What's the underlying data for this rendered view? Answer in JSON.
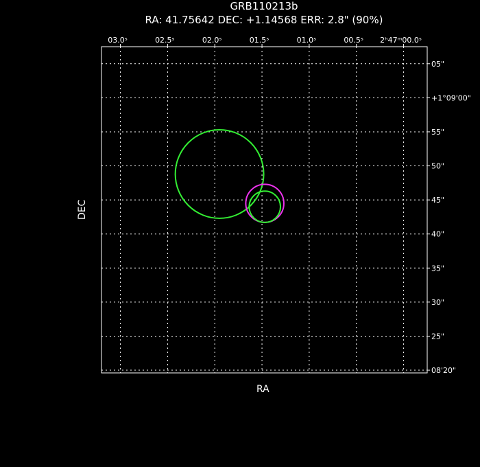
{
  "header": {
    "title": "GRB110213b",
    "subtitle": "RA: 41.75642   DEC: +1.14568   ERR: 2.8\" (90%)"
  },
  "chart_data": {
    "type": "scatter",
    "title": "GRB110213b",
    "subtitle": "RA: 41.75642   DEC: +1.14568   ERR: 2.8\" (90%)",
    "xlabel": "RA",
    "ylabel": "DEC",
    "x_axis_position": "top",
    "y_axis_position": "right",
    "x_reversed": true,
    "grid": true,
    "xlim": [
      3.2,
      -0.25
    ],
    "ylim": [
      19.6,
      67.5
    ],
    "x_ticks": [
      {
        "value": 3.0,
        "label": "03.0ˢ"
      },
      {
        "value": 2.5,
        "label": "02.5ˢ"
      },
      {
        "value": 2.0,
        "label": "02.0ˢ"
      },
      {
        "value": 1.5,
        "label": "01.5ˢ"
      },
      {
        "value": 1.0,
        "label": "01.0ˢ"
      },
      {
        "value": 0.5,
        "label": "00.5ˢ"
      },
      {
        "value": 0.0,
        "label": "2ʰ47ᵐ00.0ˢ"
      }
    ],
    "y_ticks": [
      {
        "value": 65,
        "label": "05\""
      },
      {
        "value": 60,
        "label": "+1°09'00\""
      },
      {
        "value": 55,
        "label": "55\""
      },
      {
        "value": 50,
        "label": "50\""
      },
      {
        "value": 45,
        "label": "45\""
      },
      {
        "value": 40,
        "label": "40\""
      },
      {
        "value": 35,
        "label": "35\""
      },
      {
        "value": 30,
        "label": "30\""
      },
      {
        "value": 25,
        "label": "25\""
      },
      {
        "value": 20,
        "label": "08'20\""
      }
    ],
    "error_circles": [
      {
        "ra_sec": 1.95,
        "dec_arcsec": 48.8,
        "radius_arcsec": 6.5,
        "color": "#33ee33"
      },
      {
        "ra_sec": 1.47,
        "dec_arcsec": 44.5,
        "radius_arcsec": 2.8,
        "color": "#ee33ee"
      },
      {
        "ra_sec": 1.47,
        "dec_arcsec": 44.0,
        "radius_arcsec": 2.3,
        "color": "#33ee33"
      }
    ]
  }
}
